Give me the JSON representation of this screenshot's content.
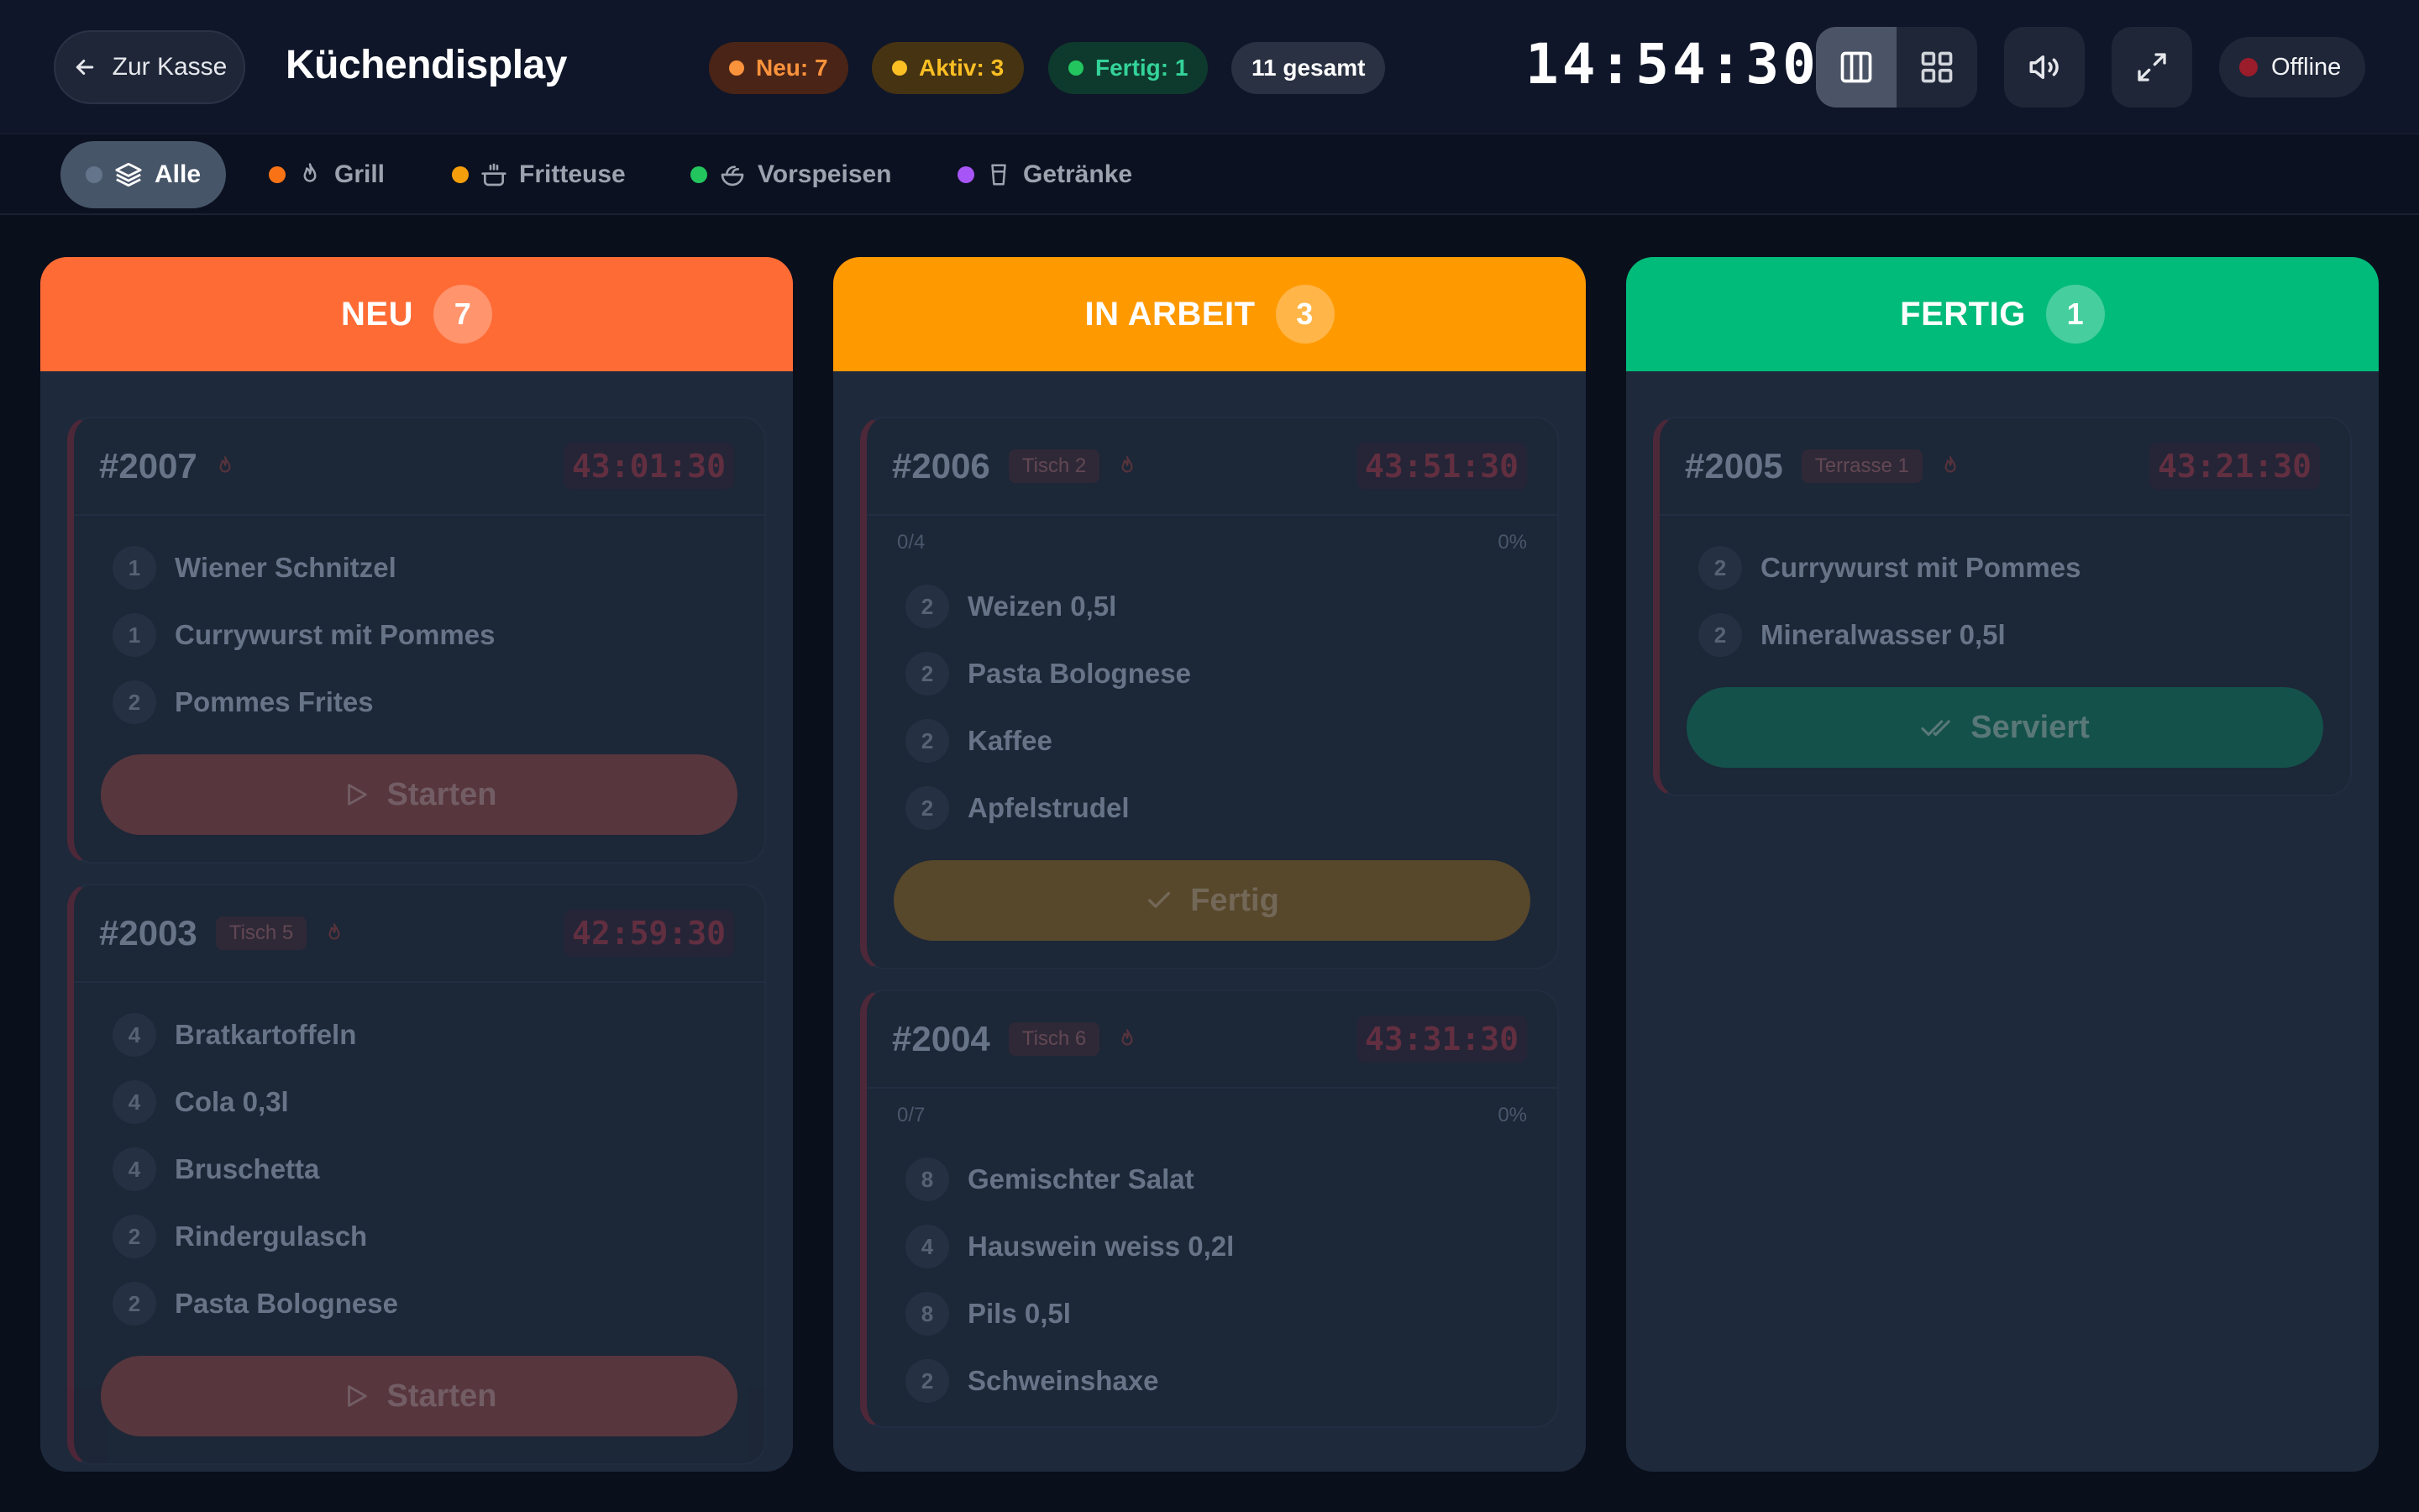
{
  "header": {
    "back_label": "Zur Kasse",
    "title": "Küchendisplay",
    "stats": {
      "new": "Neu: 7",
      "active": "Aktiv: 3",
      "done": "Fertig: 1",
      "total": "11 gesamt"
    },
    "clock": "14:54:30",
    "connection_status": "Offline"
  },
  "filters": [
    {
      "label": "Alle",
      "color": "#94a3b8",
      "icon": "layers-icon"
    },
    {
      "label": "Grill",
      "color": "#f97316",
      "icon": "flame-icon"
    },
    {
      "label": "Fritteuse",
      "color": "#f59e0b",
      "icon": "fryer-icon"
    },
    {
      "label": "Vorspeisen",
      "color": "#22c55e",
      "icon": "salad-icon"
    },
    {
      "label": "Getränke",
      "color": "#a855f7",
      "icon": "cup-icon"
    }
  ],
  "columns": {
    "new": {
      "title": "NEU",
      "count": "7",
      "color": "#ff6b35",
      "orders": [
        {
          "number": "#2007",
          "table": "",
          "timer": "43:01:30",
          "items": [
            {
              "qty": "1",
              "name": "Wiener Schnitzel"
            },
            {
              "qty": "1",
              "name": "Currywurst mit Pommes"
            },
            {
              "qty": "2",
              "name": "Pommes Frites"
            }
          ],
          "action": "Starten"
        },
        {
          "number": "#2003",
          "table": "Tisch 5",
          "timer": "42:59:30",
          "items": [
            {
              "qty": "4",
              "name": "Bratkartoffeln"
            },
            {
              "qty": "4",
              "name": "Cola 0,3l"
            },
            {
              "qty": "4",
              "name": "Bruschetta"
            },
            {
              "qty": "2",
              "name": "Rindergulasch"
            },
            {
              "qty": "2",
              "name": "Pasta Bolognese"
            }
          ],
          "action": "Starten"
        }
      ]
    },
    "work": {
      "title": "IN ARBEIT",
      "count": "3",
      "color": "#ff9900",
      "orders": [
        {
          "number": "#2006",
          "table": "Tisch 2",
          "timer": "43:51:30",
          "progress_text": "0/4",
          "progress_pct": "0%",
          "items": [
            {
              "qty": "2",
              "name": "Weizen 0,5l"
            },
            {
              "qty": "2",
              "name": "Pasta Bolognese"
            },
            {
              "qty": "2",
              "name": "Kaffee"
            },
            {
              "qty": "2",
              "name": "Apfelstrudel"
            }
          ],
          "action": "Fertig"
        },
        {
          "number": "#2004",
          "table": "Tisch 6",
          "timer": "43:31:30",
          "progress_text": "0/7",
          "progress_pct": "0%",
          "items": [
            {
              "qty": "8",
              "name": "Gemischter Salat"
            },
            {
              "qty": "4",
              "name": "Hauswein weiss 0,2l"
            },
            {
              "qty": "8",
              "name": "Pils 0,5l"
            },
            {
              "qty": "2",
              "name": "Schweinshaxe"
            }
          ]
        }
      ]
    },
    "done": {
      "title": "FERTIG",
      "count": "1",
      "color": "#00bb7a",
      "orders": [
        {
          "number": "#2005",
          "table": "Terrasse 1",
          "timer": "43:21:30",
          "items": [
            {
              "qty": "2",
              "name": "Currywurst mit Pommes"
            },
            {
              "qty": "2",
              "name": "Mineralwasser 0,5l"
            }
          ],
          "action": "Serviert"
        }
      ]
    }
  }
}
